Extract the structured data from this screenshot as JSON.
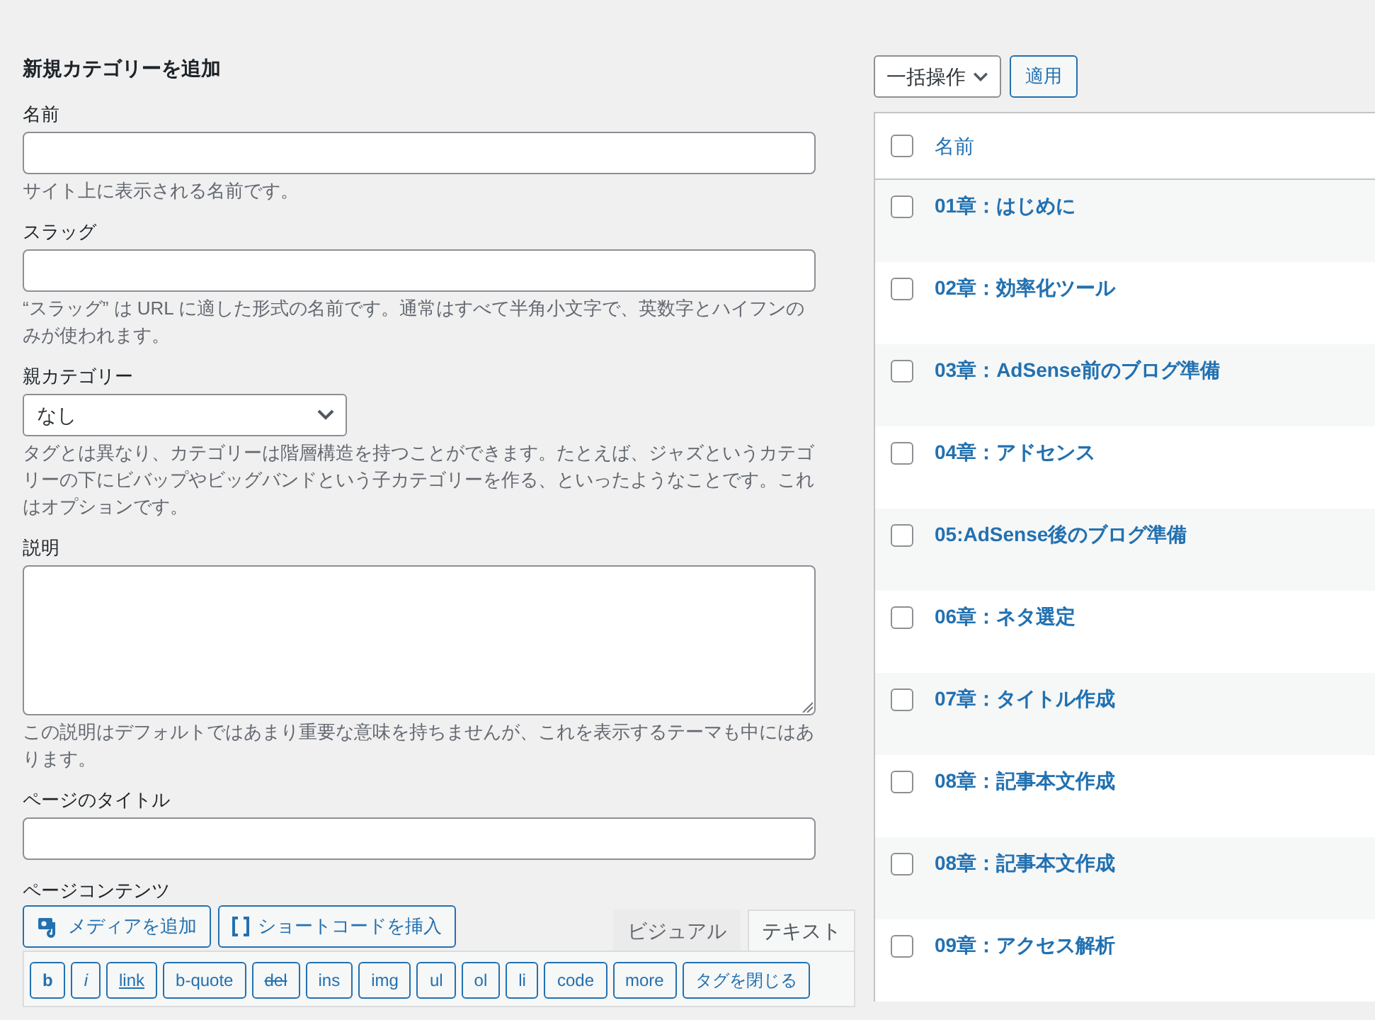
{
  "form": {
    "heading": "新規カテゴリーを追加",
    "fields": [
      {
        "kind": "input",
        "label": "名前",
        "help": "サイト上に表示される名前です。"
      },
      {
        "kind": "input",
        "label": "スラッグ",
        "help": "“スラッグ” は URL に適した形式の名前です。通常はすべて半角小文字で、英数字とハイフンのみが使われます。"
      },
      {
        "kind": "select",
        "label": "親カテゴリー",
        "value": "なし",
        "help": "タグとは異なり、カテゴリーは階層構造を持つことができます。たとえば、ジャズというカテゴリーの下にビバップやビッグバンドという子カテゴリーを作る、といったようなことです。これはオプションです。"
      },
      {
        "kind": "textarea",
        "label": "説明",
        "help": "この説明はデフォルトではあまり重要な意味を持ちませんが、これを表示するテーマも中にはあります。"
      },
      {
        "kind": "input",
        "label": "ページのタイトル"
      }
    ],
    "content_label": "ページコンテンツ",
    "media_buttons": [
      {
        "kind": "media",
        "label": "メディアを追加"
      },
      {
        "kind": "shortcode",
        "label": "ショートコードを挿入"
      }
    ],
    "editor_tabs": [
      {
        "label": "ビジュアル",
        "selected": false
      },
      {
        "label": "テキスト",
        "selected": true
      }
    ],
    "quicktags": [
      "b",
      "i",
      "link",
      "b-quote",
      "del",
      "ins",
      "img",
      "ul",
      "ol",
      "li",
      "code",
      "more",
      "タグを閉じる"
    ]
  },
  "list": {
    "bulk_action": "一括操作",
    "apply": "適用",
    "column": "名前",
    "select_all_checked": false,
    "rows": [
      {
        "name": "01章：はじめに",
        "checked": false
      },
      {
        "name": "02章：効率化ツール",
        "checked": false
      },
      {
        "name": "03章：AdSense前のブログ準備",
        "checked": false
      },
      {
        "name": "04章：アドセンス",
        "checked": false
      },
      {
        "name": "05:AdSense後のブログ準備",
        "checked": false
      },
      {
        "name": "06章：ネタ選定",
        "checked": false
      },
      {
        "name": "07章：タイトル作成",
        "checked": false
      },
      {
        "name": "08章：記事本文作成",
        "checked": false
      },
      {
        "name": "08章：記事本文作成",
        "checked": false
      },
      {
        "name": "09章：アクセス解析",
        "checked": false
      }
    ]
  }
}
